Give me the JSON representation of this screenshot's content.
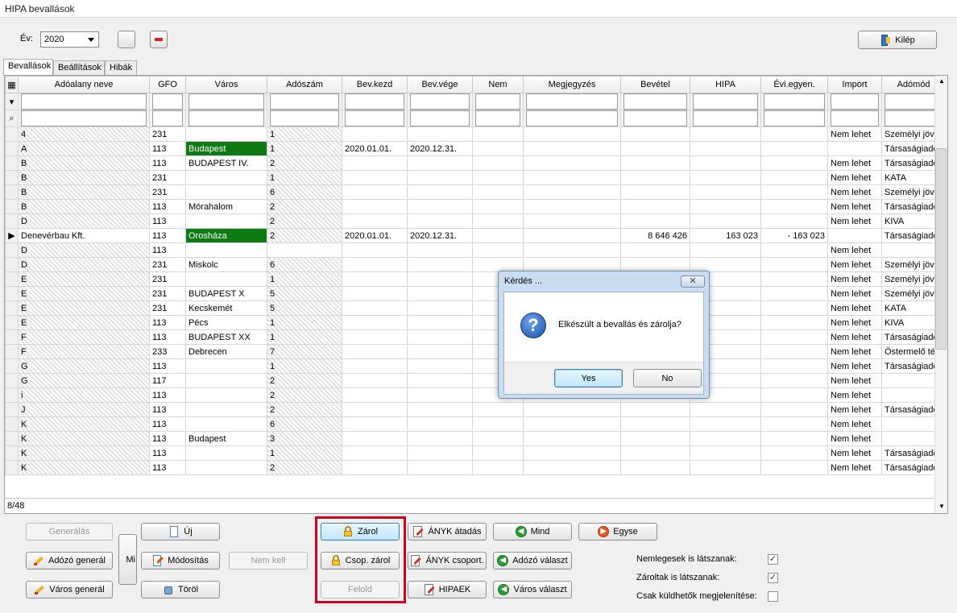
{
  "window": {
    "title": "HIPA bevallások"
  },
  "toolbar": {
    "year_label": "Év:",
    "year_value": "2020",
    "exit_label": "Kilép"
  },
  "tabs": [
    {
      "label": "Bevallások"
    },
    {
      "label": "Beállítások"
    },
    {
      "label": "Hibák"
    }
  ],
  "grid": {
    "headers": [
      "Adóalany neve",
      "GFO",
      "Város",
      "Adószám",
      "Bev.kezd",
      "Bev.vége",
      "Nem",
      "Megjegyzés",
      "Bevétel",
      "HIPA",
      "Évi.egyen.",
      "Import",
      "Adómód"
    ],
    "rows": [
      [
        "4",
        "231",
        "",
        "1",
        "",
        "",
        "",
        "",
        "",
        "",
        "",
        "Nem lehet",
        "Személyi jöve"
      ],
      [
        "A",
        "113",
        "Budapest",
        "1",
        "2020.01.01.",
        "2020.12.31.",
        "",
        "",
        "",
        "",
        "",
        "",
        "Társaságiadó"
      ],
      [
        "B",
        "113",
        "BUDAPEST IV.",
        "2",
        "",
        "",
        "",
        "",
        "",
        "",
        "",
        "Nem lehet",
        "Társaságiadó"
      ],
      [
        "B",
        "231",
        "",
        "1",
        "",
        "",
        "",
        "",
        "",
        "",
        "",
        "Nem lehet",
        "KATA"
      ],
      [
        "B",
        "231",
        "",
        "6",
        "",
        "",
        "",
        "",
        "",
        "",
        "",
        "Nem lehet",
        "Személyi jöve"
      ],
      [
        "B",
        "113",
        "Mórahalom",
        "2",
        "",
        "",
        "",
        "",
        "",
        "",
        "",
        "Nem lehet",
        "Társaságiadó"
      ],
      [
        "D",
        "113",
        "",
        "2",
        "",
        "",
        "",
        "",
        "",
        "",
        "",
        "Nem lehet",
        "KIVA"
      ],
      [
        "Denevérbau Kft.",
        "113",
        "Orosháza",
        "2",
        "2020.01.01.",
        "2020.12.31.",
        "",
        "",
        "8 646 426",
        "163 023",
        "- 163 023",
        "",
        "Társaságiadó"
      ],
      [
        "D",
        "113",
        "",
        "",
        "",
        "",
        "",
        "",
        "",
        "",
        "",
        "Nem lehet",
        ""
      ],
      [
        "D",
        "231",
        "Miskolc",
        "6",
        "",
        "",
        "",
        "",
        "",
        "",
        "",
        "Nem lehet",
        "Személyi jöve"
      ],
      [
        "E",
        "231",
        "",
        "1",
        "",
        "",
        "",
        "",
        "",
        "",
        "",
        "Nem lehet",
        "Személyi jöve"
      ],
      [
        "E",
        "231",
        "BUDAPEST X",
        "5",
        "",
        "",
        "",
        "",
        "",
        "",
        "",
        "Nem lehet",
        "Személyi jöve"
      ],
      [
        "E",
        "231",
        "Kecskemét",
        "5",
        "",
        "",
        "",
        "",
        "",
        "",
        "",
        "Nem lehet",
        "KATA"
      ],
      [
        "E",
        "113",
        "Pécs",
        "1",
        "",
        "",
        "",
        "",
        "",
        "",
        "",
        "Nem lehet",
        "KIVA"
      ],
      [
        "F",
        "113",
        "BUDAPEST XX",
        "1",
        "",
        "",
        "",
        "",
        "",
        "",
        "",
        "Nem lehet",
        "Társaságiadó"
      ],
      [
        "F",
        "233",
        "Debrecen",
        "7",
        "",
        "",
        "",
        "",
        "",
        "",
        "",
        "Nem lehet",
        "Östermelő téte"
      ],
      [
        "G",
        "113",
        "",
        "1",
        "",
        "",
        "",
        "",
        "",
        "",
        "",
        "Nem lehet",
        "Társaságiadó"
      ],
      [
        "G",
        "117",
        "",
        "2",
        "",
        "",
        "",
        "",
        "",
        "",
        "",
        "Nem lehet",
        ""
      ],
      [
        "i",
        "113",
        "",
        "2",
        "",
        "",
        "",
        "",
        "",
        "",
        "",
        "Nem lehet",
        ""
      ],
      [
        "J",
        "113",
        "",
        "2",
        "",
        "",
        "",
        "",
        "",
        "",
        "",
        "Nem lehet",
        "Társaságiadó"
      ],
      [
        "K",
        "113",
        "",
        "6",
        "",
        "",
        "",
        "",
        "",
        "",
        "",
        "Nem lehet",
        ""
      ],
      [
        "K",
        "113",
        "Budapest",
        "3",
        "",
        "",
        "",
        "",
        "",
        "",
        "",
        "Nem lehet",
        ""
      ],
      [
        "K",
        "113",
        "",
        "1",
        "",
        "",
        "",
        "",
        "",
        "",
        "",
        "Nem lehet",
        "Társaságiadó"
      ],
      [
        "K",
        "113",
        "",
        "2",
        "",
        "",
        "",
        "",
        "",
        "",
        "",
        "Nem lehet",
        "Társaságiadó"
      ]
    ],
    "current_row_index": 7,
    "record_counter": "8/48"
  },
  "dialog": {
    "title": "Kérdés ...",
    "message": "Elkészült a bevallás és zárolja?",
    "yes_label": "Yes",
    "no_label": "No"
  },
  "buttons": {
    "generalas": "Generálás",
    "adozo_generral": "Adózó generál",
    "varos_general": "Város generál",
    "mi": "Mi",
    "uj": "Új",
    "modositas": "Módosítás",
    "torol": "Töröl",
    "nem_kell": "Nem kell",
    "zarol": "Zárol",
    "csop_zarol": "Csop. zárol",
    "felold": "Felold",
    "anyk_atadas": "ÁNYK átadás",
    "anyk_csoport": "ÁNYK csoport.",
    "hipaek": "HIPAEK",
    "mind": "Mind",
    "adozo_valaszt": "Adózó választ",
    "varos_valaszt": "Város választ",
    "egyse": "Egyse"
  },
  "options": {
    "nemlegesek_label": "Nemlegesek is látszanak:",
    "nemlegesek_checked": true,
    "zaroltak_label": "Zároltak is látszanak:",
    "zaroltak_checked": true,
    "csak_kuldhetok_label": "Csak küldhetők megjelenítése:",
    "csak_kuldhetok_checked": false
  },
  "colors": {
    "highlight_green": "#0f7a13",
    "selection_red": "#d0021b",
    "dialog_frame": "#c9dcf2"
  }
}
